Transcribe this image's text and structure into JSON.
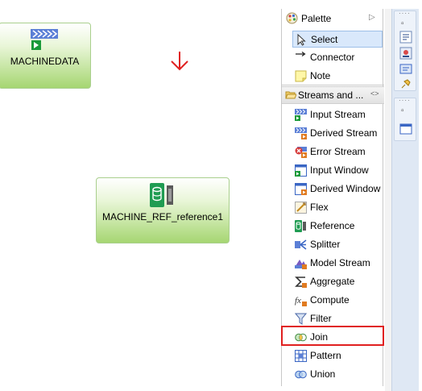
{
  "canvas": {
    "nodes": [
      {
        "label": "MACHINEDATA"
      },
      {
        "label": "MACHINE_REF_reference1"
      }
    ],
    "colors": {
      "node_fill": "#a6d672",
      "drop_arrow": "#e02020"
    }
  },
  "palette": {
    "title": "Palette",
    "tools": [
      {
        "label": "Select",
        "icon": "cursor-arrow-icon"
      },
      {
        "label": "Connector",
        "icon": "connector-arrow-icon"
      },
      {
        "label": "Note",
        "icon": "note-icon"
      }
    ],
    "drawer": {
      "label": "Streams and ...",
      "items": [
        {
          "label": "Input Stream",
          "icon": "input-stream-icon"
        },
        {
          "label": "Derived Stream",
          "icon": "derived-stream-icon"
        },
        {
          "label": "Error Stream",
          "icon": "error-stream-icon"
        },
        {
          "label": "Input Window",
          "icon": "input-window-icon"
        },
        {
          "label": "Derived Window",
          "icon": "derived-window-icon"
        },
        {
          "label": "Flex",
          "icon": "flex-icon"
        },
        {
          "label": "Reference",
          "icon": "reference-icon"
        },
        {
          "label": "Splitter",
          "icon": "splitter-icon"
        },
        {
          "label": "Model Stream",
          "icon": "model-stream-icon"
        },
        {
          "label": "Aggregate",
          "icon": "aggregate-icon"
        },
        {
          "label": "Compute",
          "icon": "compute-icon"
        },
        {
          "label": "Filter",
          "icon": "filter-icon"
        },
        {
          "label": "Join",
          "icon": "join-icon"
        },
        {
          "label": "Pattern",
          "icon": "pattern-icon"
        },
        {
          "label": "Union",
          "icon": "union-icon"
        }
      ]
    },
    "highlighted_item": "Join",
    "selected_tool": "Select",
    "highlight_color": "#e02020"
  }
}
